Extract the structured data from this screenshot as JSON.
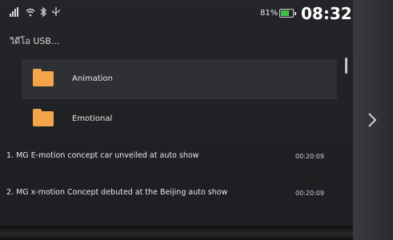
{
  "status": {
    "battery_pct": "81%",
    "clock": "08:32"
  },
  "breadcrumb": "วิดีโอ USB...",
  "folders": [
    {
      "name": "Animation"
    },
    {
      "name": "Emotional"
    }
  ],
  "tracks": [
    {
      "title": "1. MG E-motion concept car unveiled at auto show",
      "duration": "00:20:09"
    },
    {
      "title": "2. MG x-motion Concept debuted at the Beijing auto show",
      "duration": "00:20:09"
    }
  ],
  "icons": {
    "signal": "signal-icon",
    "wifi": "wifi-icon",
    "bluetooth": "bluetooth-icon",
    "usb": "usb-icon",
    "battery": "battery-icon",
    "folder": "folder-icon",
    "next": "chevron-right-icon"
  },
  "colors": {
    "folder": "#f4a54a",
    "battery": "#3ec24a",
    "selected_row": "#2f3034"
  }
}
